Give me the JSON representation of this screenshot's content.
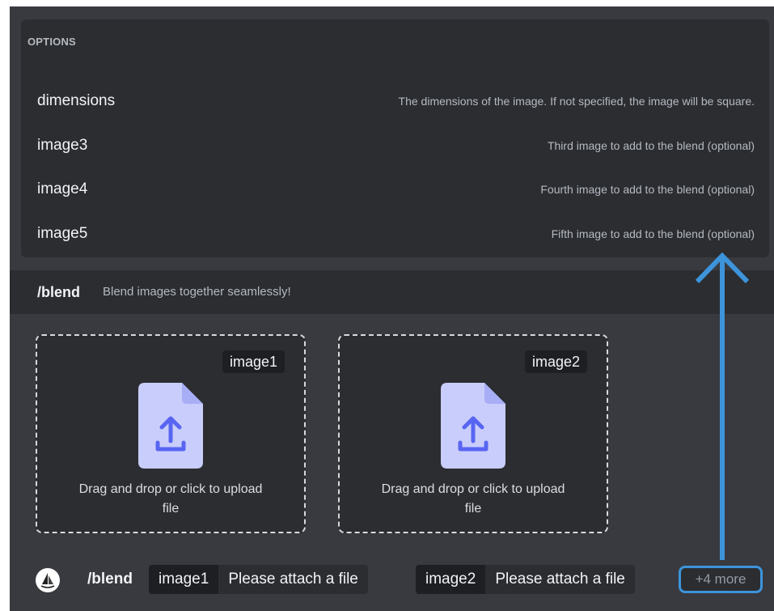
{
  "options": {
    "heading": "OPTIONS",
    "items": [
      {
        "name": "dimensions",
        "description": "The dimensions of the image. If not specified, the image will be square."
      },
      {
        "name": "image3",
        "description": "Third image to add to the blend (optional)"
      },
      {
        "name": "image4",
        "description": "Fourth image to add to the blend (optional)"
      },
      {
        "name": "image5",
        "description": "Fifth image to add to the blend (optional)"
      }
    ]
  },
  "command": {
    "name": "/blend",
    "description": "Blend images together seamlessly!"
  },
  "dropzones": [
    {
      "tag": "image1",
      "text": "Drag and drop or click to upload file"
    },
    {
      "tag": "image2",
      "text": "Drag and drop or click to upload file"
    }
  ],
  "input": {
    "command": "/blend",
    "params": [
      {
        "key": "image1",
        "value": "Please attach a file"
      },
      {
        "key": "image2",
        "value": "Please attach a file"
      }
    ],
    "more": "+4 more"
  },
  "colors": {
    "accent": "#3d94da",
    "upload_icon": "#c9cdfb",
    "upload_glyph": "#5865f2"
  },
  "icons": {
    "upload": "file-upload-icon",
    "avatar": "sailboat-logo-icon",
    "annotation": "arrow-up-icon"
  }
}
